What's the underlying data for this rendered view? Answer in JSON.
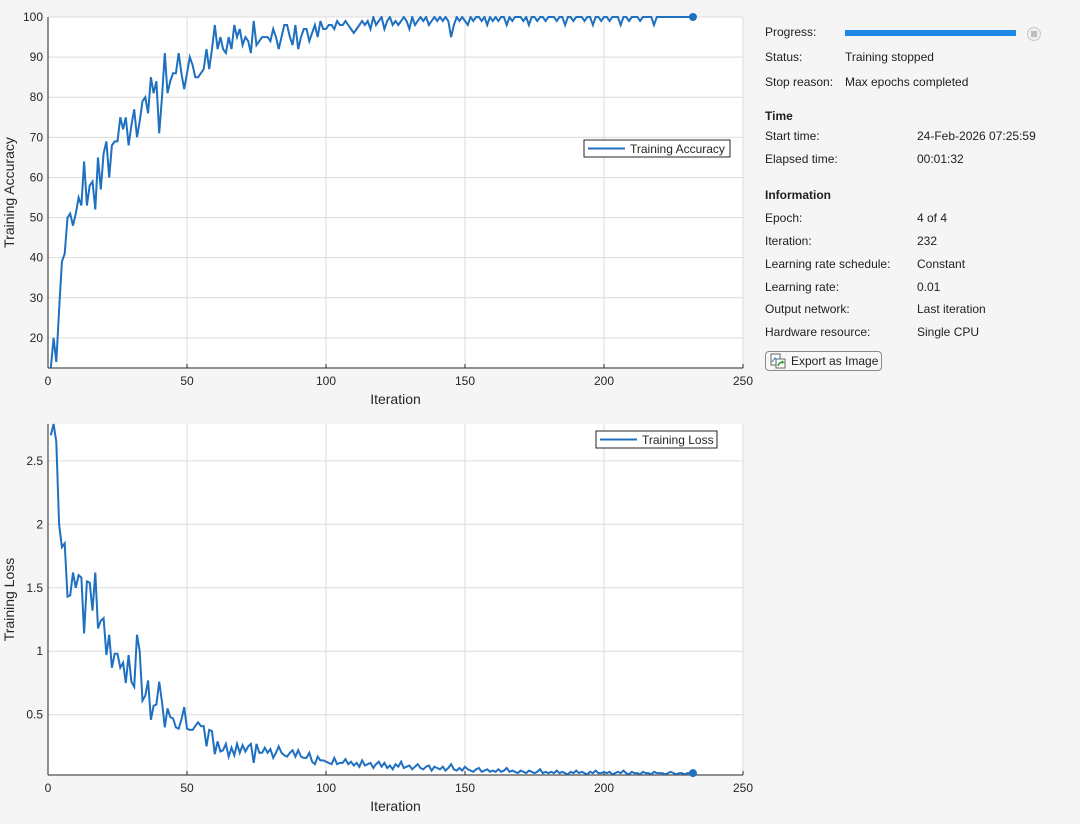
{
  "panel": {
    "progress_label": "Progress:",
    "progress_fraction": 1.0,
    "status_label": "Status:",
    "status_value": "Training stopped",
    "stop_reason_label": "Stop reason:",
    "stop_reason_value": "Max epochs completed",
    "time_header": "Time",
    "start_time_label": "Start time:",
    "start_time_value": "24-Feb-2026 07:25:59",
    "elapsed_label": "Elapsed time:",
    "elapsed_value": "00:01:32",
    "info_header": "Information",
    "epoch_label": "Epoch:",
    "epoch_value": "4 of 4",
    "iteration_label": "Iteration:",
    "iteration_value": "232",
    "lr_schedule_label": "Learning rate schedule:",
    "lr_schedule_value": "Constant",
    "lr_label": "Learning rate:",
    "lr_value": "0.01",
    "output_label": "Output network:",
    "output_value": "Last iteration",
    "hardware_label": "Hardware resource:",
    "hardware_value": "Single CPU",
    "export_button": "Export as Image"
  },
  "colors": {
    "line": "#1f70c1",
    "progress": "#1e88e5"
  },
  "chart_data": [
    {
      "type": "line",
      "title": "",
      "xlabel": "Iteration",
      "ylabel": "Training Accuracy",
      "xlim": [
        0,
        250
      ],
      "ylim": [
        12.5,
        100
      ],
      "xticks": [
        0,
        50,
        100,
        150,
        200,
        250
      ],
      "yticks": [
        20,
        30,
        40,
        50,
        60,
        70,
        80,
        90,
        100
      ],
      "grid": true,
      "legend": "right",
      "series": [
        {
          "name": "Training Accuracy",
          "x_start": 1,
          "values": [
            12.5,
            20,
            14,
            27,
            39,
            41,
            50,
            51,
            48,
            51,
            55,
            53,
            64,
            53,
            58,
            59,
            52,
            65,
            57,
            66,
            69,
            60,
            68,
            69,
            69,
            75,
            72,
            75,
            68,
            73,
            77,
            70,
            74,
            79,
            80,
            76,
            85,
            81,
            84,
            71,
            80,
            91,
            81,
            84,
            86,
            86,
            91,
            86,
            82,
            86,
            90,
            88,
            85,
            85,
            86,
            87,
            92,
            87,
            92,
            98,
            92,
            95,
            92,
            91,
            95,
            92,
            98,
            95,
            97,
            93,
            95,
            94,
            91,
            99,
            93,
            94,
            95,
            95,
            95,
            94,
            97,
            95,
            92,
            95,
            98,
            98,
            95,
            93,
            98,
            92,
            95,
            97,
            97,
            94,
            96,
            98,
            95,
            99,
            97,
            97,
            98,
            98,
            97,
            99,
            98,
            98,
            99,
            98,
            97,
            96,
            97,
            98,
            99,
            98,
            99,
            97,
            100,
            98,
            99,
            100,
            97,
            99,
            100,
            98,
            99,
            98,
            99,
            100,
            99,
            97,
            100,
            98,
            99,
            100,
            99,
            100,
            98,
            99,
            100,
            99,
            100,
            99,
            100,
            99,
            95,
            98,
            100,
            99,
            100,
            99,
            98,
            100,
            99,
            100,
            100,
            99,
            100,
            98,
            100,
            99,
            100,
            99,
            100,
            100,
            98,
            100,
            99,
            100,
            100,
            100,
            99,
            100,
            98,
            100,
            100,
            99,
            100,
            100,
            99,
            100,
            100,
            100,
            99,
            100,
            100,
            98,
            100,
            100,
            99,
            100,
            100,
            100,
            99,
            100,
            100,
            98,
            100,
            100,
            99,
            100,
            100,
            99,
            100,
            100,
            100,
            98,
            100,
            100,
            99,
            100,
            100,
            100,
            99,
            100,
            100,
            100,
            100,
            98,
            100,
            100,
            100,
            100,
            100,
            100,
            100,
            100,
            100,
            100,
            100,
            100,
            100,
            100
          ]
        }
      ]
    },
    {
      "type": "line",
      "title": "",
      "xlabel": "Iteration",
      "ylabel": "Training Loss",
      "xlim": [
        0,
        250
      ],
      "ylim": [
        0.025,
        2.79
      ],
      "xticks": [
        0,
        50,
        100,
        150,
        200,
        250
      ],
      "yticks": [
        0.5,
        1,
        1.5,
        2,
        2.5
      ],
      "ytick_labels": [
        "0.5",
        "1",
        "1.5",
        "2",
        "2.5"
      ],
      "grid": true,
      "legend": "top-right",
      "series": [
        {
          "name": "Training Loss",
          "x_start": 1,
          "values": [
            2.7,
            2.79,
            2.65,
            2.0,
            1.82,
            1.85,
            1.43,
            1.44,
            1.62,
            1.5,
            1.6,
            1.58,
            1.14,
            1.55,
            1.54,
            1.32,
            1.62,
            1.18,
            1.24,
            1.26,
            0.97,
            1.13,
            0.87,
            0.98,
            0.98,
            0.87,
            0.91,
            0.75,
            0.97,
            0.76,
            0.72,
            1.13,
            1.0,
            0.61,
            0.65,
            0.77,
            0.46,
            0.57,
            0.58,
            0.76,
            0.6,
            0.4,
            0.55,
            0.48,
            0.47,
            0.4,
            0.39,
            0.46,
            0.56,
            0.39,
            0.38,
            0.38,
            0.41,
            0.44,
            0.41,
            0.41,
            0.25,
            0.38,
            0.37,
            0.19,
            0.29,
            0.21,
            0.22,
            0.27,
            0.17,
            0.24,
            0.18,
            0.27,
            0.2,
            0.26,
            0.21,
            0.25,
            0.27,
            0.12,
            0.27,
            0.2,
            0.2,
            0.24,
            0.2,
            0.23,
            0.16,
            0.2,
            0.25,
            0.2,
            0.18,
            0.17,
            0.2,
            0.22,
            0.17,
            0.22,
            0.17,
            0.16,
            0.16,
            0.2,
            0.13,
            0.11,
            0.17,
            0.14,
            0.14,
            0.13,
            0.12,
            0.11,
            0.16,
            0.11,
            0.12,
            0.12,
            0.15,
            0.11,
            0.13,
            0.1,
            0.12,
            0.09,
            0.14,
            0.1,
            0.11,
            0.12,
            0.08,
            0.11,
            0.13,
            0.09,
            0.12,
            0.08,
            0.1,
            0.07,
            0.11,
            0.09,
            0.13,
            0.08,
            0.09,
            0.1,
            0.07,
            0.09,
            0.11,
            0.08,
            0.07,
            0.09,
            0.1,
            0.06,
            0.09,
            0.08,
            0.07,
            0.09,
            0.06,
            0.08,
            0.11,
            0.07,
            0.06,
            0.08,
            0.06,
            0.09,
            0.07,
            0.06,
            0.05,
            0.07,
            0.08,
            0.05,
            0.06,
            0.07,
            0.05,
            0.06,
            0.05,
            0.07,
            0.05,
            0.06,
            0.08,
            0.05,
            0.06,
            0.05,
            0.04,
            0.06,
            0.05,
            0.04,
            0.06,
            0.05,
            0.04,
            0.05,
            0.07,
            0.04,
            0.05,
            0.04,
            0.05,
            0.04,
            0.06,
            0.04,
            0.05,
            0.04,
            0.03,
            0.05,
            0.04,
            0.06,
            0.04,
            0.05,
            0.04,
            0.03,
            0.05,
            0.04,
            0.06,
            0.04,
            0.04,
            0.05,
            0.04,
            0.05,
            0.03,
            0.04,
            0.05,
            0.04,
            0.06,
            0.04,
            0.03,
            0.05,
            0.04,
            0.04,
            0.03,
            0.05,
            0.04,
            0.04,
            0.03,
            0.05,
            0.04,
            0.04,
            0.04,
            0.03,
            0.04,
            0.05,
            0.04,
            0.03,
            0.04,
            0.04,
            0.03,
            0.04,
            0.04,
            0.04
          ]
        }
      ]
    }
  ]
}
